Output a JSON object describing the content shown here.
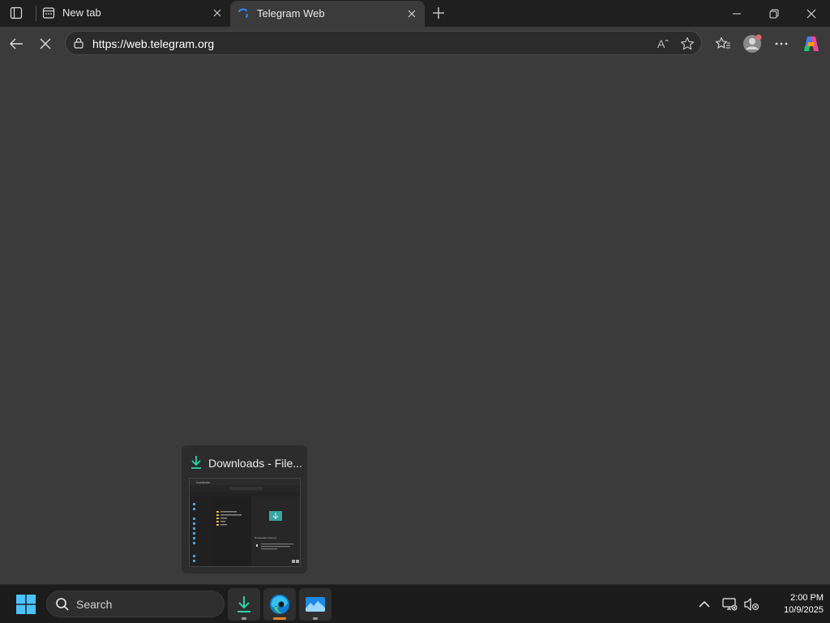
{
  "browser": {
    "tabs": [
      {
        "title": "New tab",
        "favicon": "newtab-icon",
        "active": false
      },
      {
        "title": "Telegram Web",
        "favicon": "loading-spinner-icon",
        "active": true
      }
    ],
    "address_url": "https://web.telegram.org",
    "address_read_aloud": "Aˆ",
    "colors": {
      "accent": "#0078d4",
      "page_background": "#3b3b3b"
    }
  },
  "thumbnail": {
    "title": "Downloads - File...",
    "icon": "download-icon",
    "preview_text": {
      "window_title": "Downloads",
      "panel_heading": "Downloads is Empty"
    }
  },
  "taskbar": {
    "search_label": "Search",
    "apps": [
      {
        "name": "file-explorer-downloads",
        "running": true,
        "active": false
      },
      {
        "name": "microsoft-edge",
        "running": true,
        "active": true
      },
      {
        "name": "photos-app",
        "running": true,
        "active": false
      }
    ],
    "clock": {
      "time": "2:00 PM",
      "date": "10/9/2025"
    }
  }
}
